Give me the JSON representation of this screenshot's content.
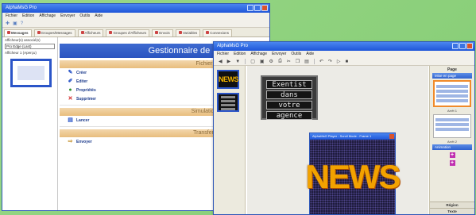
{
  "window1": {
    "title": "AlphaMsG Pro",
    "menu": [
      "Fichier",
      "Edition",
      "Affichage",
      "Envoyer",
      "Outils",
      "Aide"
    ],
    "tabs": [
      {
        "label": "Messages",
        "active": true
      },
      {
        "label": "Groupes/Messages",
        "active": false
      },
      {
        "label": "Afficheurs",
        "active": false
      },
      {
        "label": "Groupes d'Afficheurs",
        "active": false
      },
      {
        "label": "Envois",
        "active": false
      },
      {
        "label": "Variables",
        "active": false
      },
      {
        "label": "Connexions",
        "active": false
      }
    ],
    "left": {
      "label": "Afficheur(s) associé(s)",
      "select_value": "Pro Edge (Last)",
      "sub_label": "Afficheur 1 (Aperçu)"
    },
    "main_title": "Gestionnaire de Messages",
    "sections": [
      {
        "title": "Fichier",
        "actions": [
          {
            "label": "Créer",
            "icon": "create-icon"
          },
          {
            "label": "Editer",
            "icon": "edit-icon"
          },
          {
            "label": "Propriétés",
            "icon": "properties-icon"
          },
          {
            "label": "Supprimer",
            "icon": "delete-icon"
          }
        ]
      },
      {
        "title": "Simulation",
        "actions": [
          {
            "label": "Lancer",
            "icon": "run-icon"
          }
        ]
      },
      {
        "title": "Transfert",
        "actions": [
          {
            "label": "Envoyer",
            "icon": "send-icon"
          }
        ]
      }
    ]
  },
  "window2": {
    "title": "AlphaMsG Pro",
    "menu": [
      "Fichier",
      "Edition",
      "Affichage",
      "Envoyer",
      "Outils",
      "Aide"
    ],
    "display_lines": [
      "Exentist",
      "dans",
      "votre",
      "agence"
    ],
    "news_window_title": "AlphaMsG Player - Scroll Mode - Frame 1",
    "news_text": "NEWS",
    "thumb1_text": "NEWS",
    "right": {
      "header": "Page",
      "bar1": "Mise en page",
      "caption1": "Arrêt 1",
      "caption2": "Arrêt 2",
      "bar2": "Animation",
      "footer1": "Région",
      "footer2": "Texte"
    }
  }
}
